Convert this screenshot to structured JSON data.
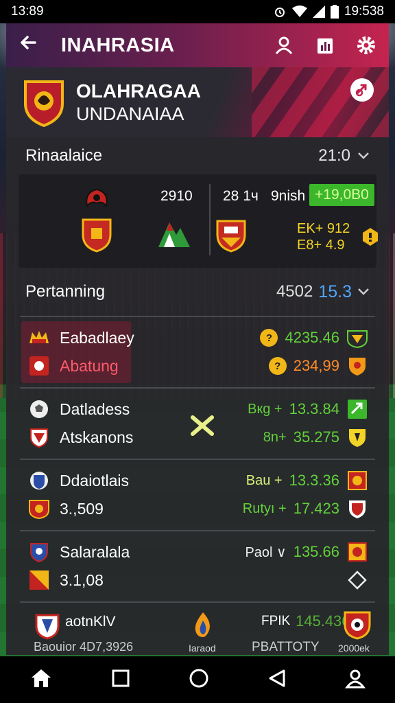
{
  "status": {
    "time": "13:89",
    "right_time": "19:538"
  },
  "appbar": {
    "title": "INAHRASIA"
  },
  "team": {
    "line1": "OLAHRAGAA",
    "line2": "UNDANAIAA"
  },
  "section1": {
    "label": "Rinaalaice",
    "value": "21:0"
  },
  "match": {
    "left_score": "2910",
    "right_a": "28 1ч",
    "right_b": "9nish",
    "badge": "+19,0B0",
    "stat1": "EK+ 912",
    "stat2": "E8+ 4.9"
  },
  "section2": {
    "label": "Pertanning",
    "value_a": "4502",
    "value_b": "15.3"
  },
  "rows": [
    {
      "name1": "Eabadlaey",
      "name2": "Abatung",
      "val1": "4235.46",
      "val2": "234,99",
      "coin1": "?",
      "coin2": "?"
    },
    {
      "name1": "Datladess",
      "name2": "Atskanons",
      "label1": "Bкg +",
      "val1": "13.3.84",
      "label2": "8n+",
      "val2": "35.275"
    },
    {
      "name1": "Ddaiotlais",
      "name2": "3.,509",
      "label1": "Bau +",
      "val1": "13.3.36",
      "label2": "Rutyı +",
      "val2": "17.423"
    },
    {
      "name1": "Salaralala",
      "name2": "3.1,08",
      "label1": "Paol ∨",
      "val1": "135.66"
    }
  ],
  "bottom_row": {
    "name": "aotnKlV",
    "sub": "Baouior 4D7,3926",
    "label_mid": "Iaraod",
    "label_b": "FPIK",
    "val": "145.436",
    "label_c": "PBATTOTY",
    "label_d": "2000ek"
  },
  "colors": {
    "accent": "#c4244f",
    "green": "#62d13a",
    "blue": "#4ea6ff",
    "orange": "#ff8a2a"
  }
}
